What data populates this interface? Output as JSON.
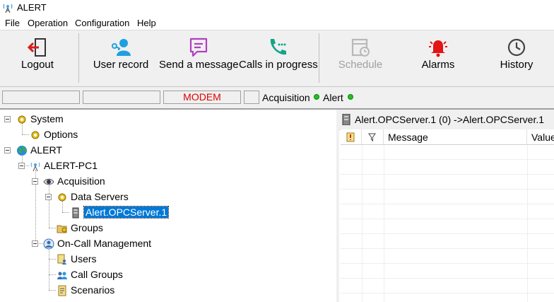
{
  "window": {
    "title": "ALERT"
  },
  "menu": [
    "File",
    "Operation",
    "Configuration",
    "Help"
  ],
  "toolbar": {
    "logout": "Logout",
    "user_record": "User record",
    "send_message": "Send a message",
    "calls_in_progress": "Calls in progress",
    "schedule": "Schedule",
    "alarms": "Alarms",
    "history": "History"
  },
  "status": {
    "modem": "MODEM",
    "acquisition": "Acquisition",
    "alert": "Alert"
  },
  "tree": {
    "system": "System",
    "options": "Options",
    "alert": "ALERT",
    "pc": "ALERT-PC1",
    "acquisition": "Acquisition",
    "data_servers": "Data Servers",
    "opc_server": "Alert.OPCServer.1",
    "groups": "Groups",
    "on_call": "On-Call Management",
    "users": "Users",
    "call_groups": "Call Groups",
    "scenarios": "Scenarios"
  },
  "right": {
    "header": "Alert.OPCServer.1 (0) ->Alert.OPCServer.1",
    "columns": {
      "message": "Message",
      "value": "Value"
    }
  },
  "colors": {
    "accent": "#0078d7",
    "modem": "#e00000",
    "status_ok": "#22c022"
  }
}
